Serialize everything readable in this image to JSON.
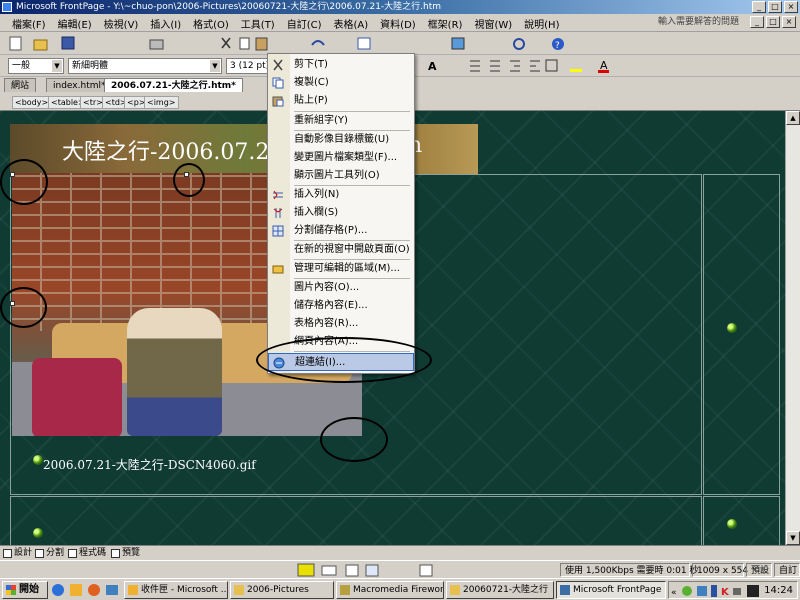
{
  "window": {
    "title": "Microsoft FrontPage - Y:\\~chuo-pon\\2006-Pictures\\20060721-大陸之行\\2006.07.21-大陸之行.htm",
    "controls": [
      "_",
      "□",
      "×"
    ]
  },
  "menubar": {
    "items": [
      "檔案(F)",
      "編輯(E)",
      "檢視(V)",
      "插入(I)",
      "格式(O)",
      "工具(T)",
      "自訂(C)",
      "表格(A)",
      "資料(D)",
      "框架(R)",
      "視窗(W)",
      "說明(H)"
    ],
    "help_placeholder": "輸入需要解答的問題"
  },
  "format_toolbar": {
    "style": "一般",
    "font": "新細明體",
    "size": "3 (12 pt)"
  },
  "tabs": [
    {
      "label": "網站",
      "active": false
    },
    {
      "label": "index.html*",
      "active": false
    },
    {
      "label": "2006.07.21-大陸之行.htm*",
      "active": true
    }
  ],
  "tag_selector": [
    "<body>",
    "<table>",
    "<tr>",
    "<td>",
    "<p>",
    "<img>"
  ],
  "document": {
    "banner_title": "大陸之行-2006.07.21",
    "banner_title_tail": "n",
    "caption": "2006.07.21-大陸之行-DSCN4060.gif"
  },
  "context_menu": {
    "items": [
      {
        "label": "剪下(T)",
        "icon": "scissors-icon"
      },
      {
        "label": "複製(C)",
        "icon": "copy-icon"
      },
      {
        "label": "貼上(P)",
        "icon": "paste-icon"
      },
      {
        "label": "重新組字(Y)",
        "icon": ""
      },
      {
        "label": "自動影像目錄標籤(U)",
        "icon": ""
      },
      {
        "label": "變更圖片檔案類型(F)...",
        "icon": ""
      },
      {
        "label": "顯示圖片工具列(O)",
        "icon": ""
      },
      {
        "label": "插入列(N)",
        "icon": "insert-row-icon"
      },
      {
        "label": "插入欄(S)",
        "icon": "insert-column-icon"
      },
      {
        "label": "分割儲存格(P)...",
        "icon": "split-cells-icon"
      },
      {
        "label": "在新的視窗中開啟頁面(O)",
        "icon": ""
      },
      {
        "label": "管理可編輯的區域(M)...",
        "icon": "editable-region-icon"
      },
      {
        "label": "圖片內容(O)...",
        "icon": ""
      },
      {
        "label": "儲存格內容(E)...",
        "icon": ""
      },
      {
        "label": "表格內容(R)...",
        "icon": ""
      },
      {
        "label": "網頁內容(A)...",
        "icon": ""
      },
      {
        "label": "超連結(I)...",
        "icon": "hyperlink-icon",
        "highlighted": true
      }
    ]
  },
  "view_tabs": [
    "設計",
    "分割",
    "程式碼",
    "預覽"
  ],
  "statusbar": {
    "speed": "使用 1,500Kbps 需要時 0:01 秒",
    "size": "1009 x 554",
    "mode": "預設",
    "custom": "自訂"
  },
  "taskbar": {
    "start": "開始",
    "tasks": [
      {
        "label": "收件匣 - Microsoft ...",
        "active": false
      },
      {
        "label": "2006-Pictures",
        "active": false
      },
      {
        "label": "Macromedia Firewor...",
        "active": false
      },
      {
        "label": "20060721-大陸之行",
        "active": false
      },
      {
        "label": "Microsoft FrontPage ...",
        "active": true
      }
    ],
    "clock": "14:24"
  },
  "colors": {
    "page_background": "#0f3b33",
    "menu_highlight": "#b9c9e6",
    "title_bar": "#0a246a"
  }
}
